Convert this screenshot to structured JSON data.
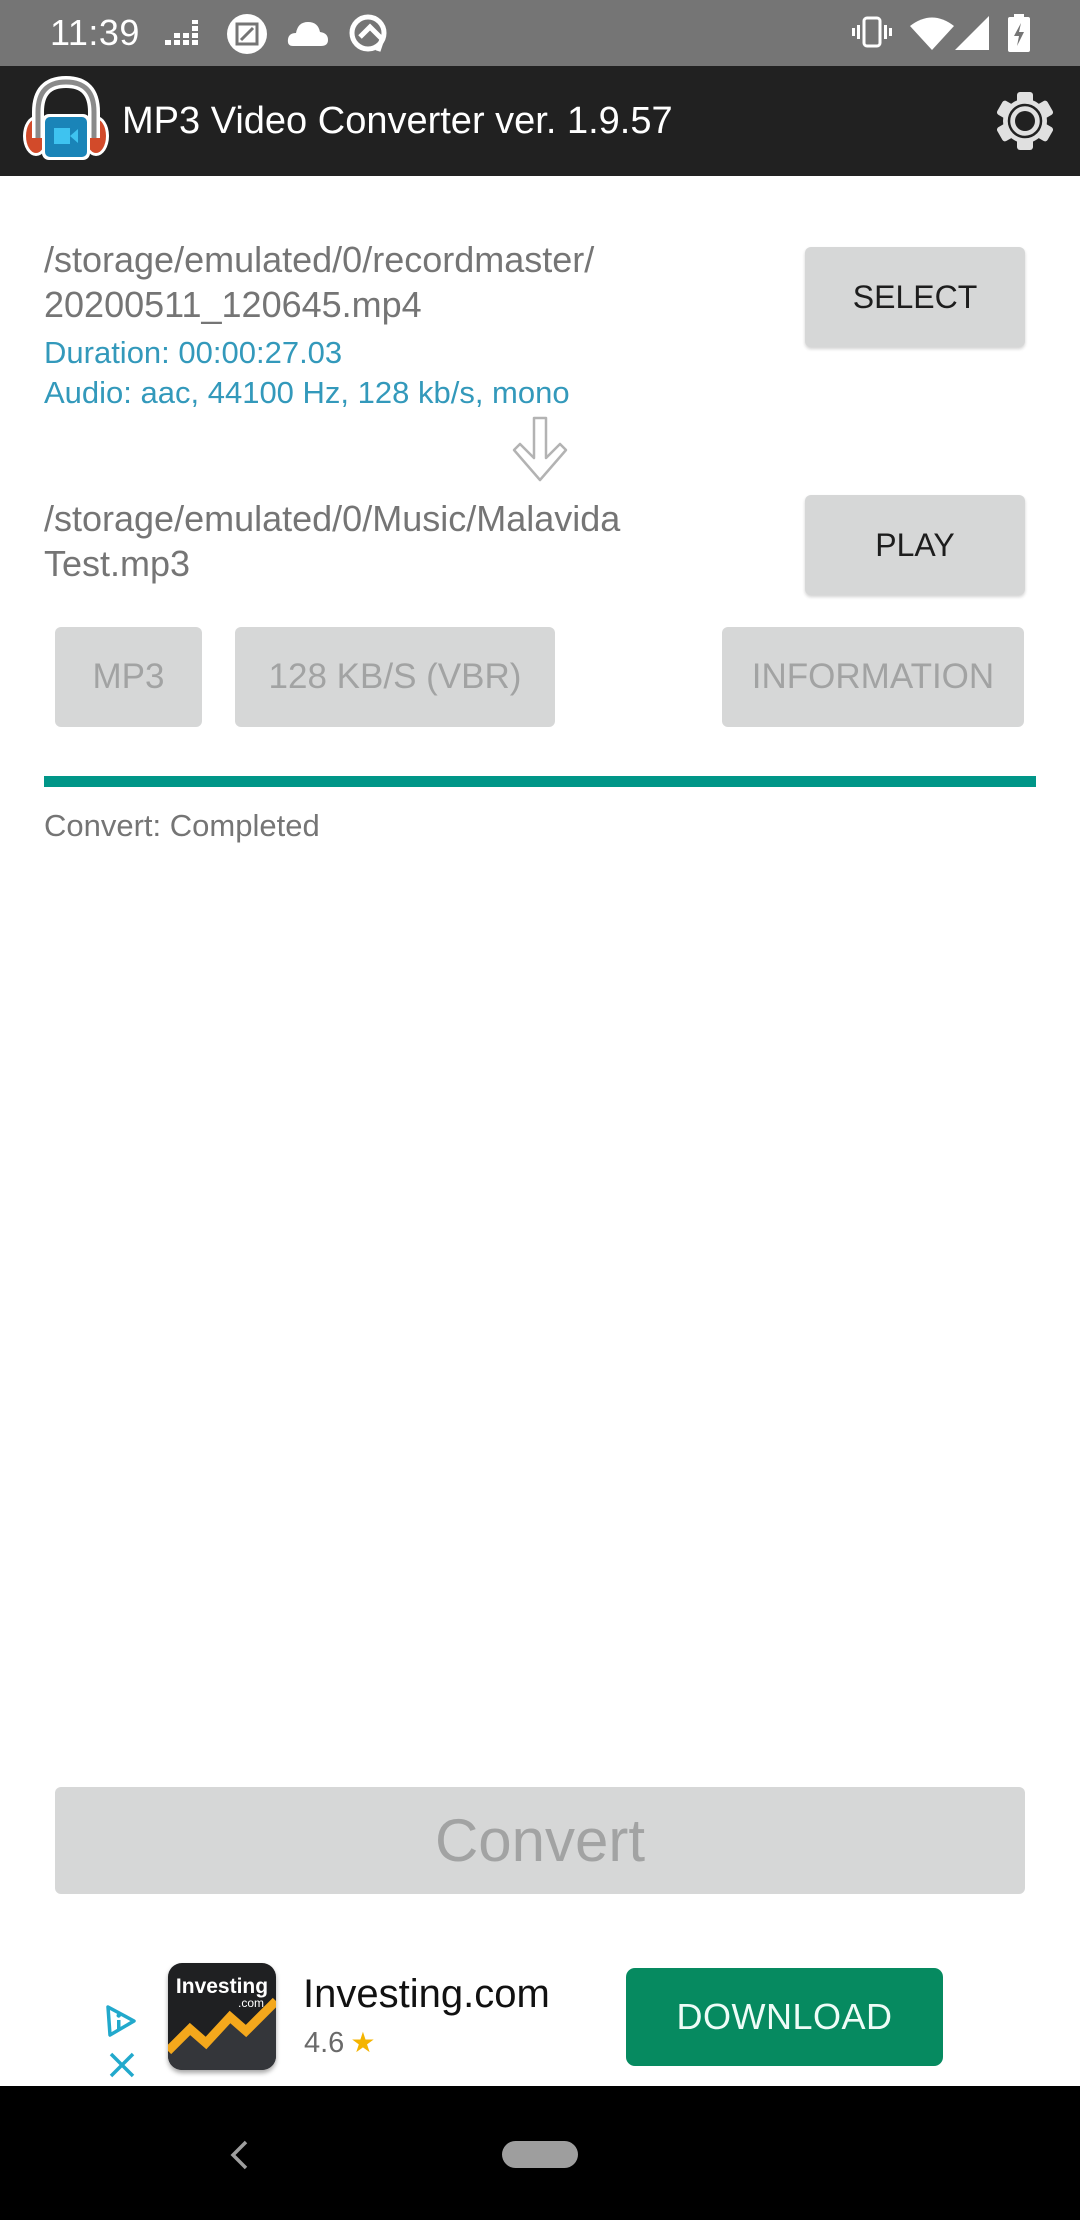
{
  "status_bar": {
    "time": "11:39",
    "left_icons": [
      "equalizer-icon",
      "screenshot-edit-icon",
      "cloud-icon",
      "q-logo-icon"
    ],
    "right_icons": [
      "vibrate-icon",
      "wifi-icon",
      "cell-signal-icon",
      "battery-charging-icon"
    ]
  },
  "app_bar": {
    "title": "MP3 Video Converter ver. 1.9.57",
    "logo": "app-logo-icon",
    "settings_icon": "gear-icon"
  },
  "input": {
    "path_line1": "/storage/emulated/0/recordmaster/",
    "path_line2": "20200511_120645.mp4",
    "duration": "Duration: 00:00:27.03",
    "audio": "Audio: aac, 44100 Hz, 128 kb/s, mono",
    "select_label": "SELECT"
  },
  "output": {
    "path_line1": "/storage/emulated/0/Music/Malavida",
    "path_line2": "Test.mp3",
    "play_label": "PLAY"
  },
  "options": {
    "format_label": "MP3",
    "bitrate_label": "128 KB/S (VBR)",
    "information_label": "INFORMATION"
  },
  "progress": {
    "fraction": 1.0,
    "color": "#009688",
    "status": "Convert: Completed"
  },
  "convert_button": {
    "label": "Convert"
  },
  "ad": {
    "app_name": "Investing.com",
    "icon_text_top": "Investing",
    "icon_text_bottom": ".com",
    "rating": "4.6",
    "star": "★",
    "cta_label": "DOWNLOAD",
    "cta_color": "#068a60"
  },
  "nav_bar": {
    "back_icon": "back-icon",
    "home_icon": "home-pill-icon"
  }
}
